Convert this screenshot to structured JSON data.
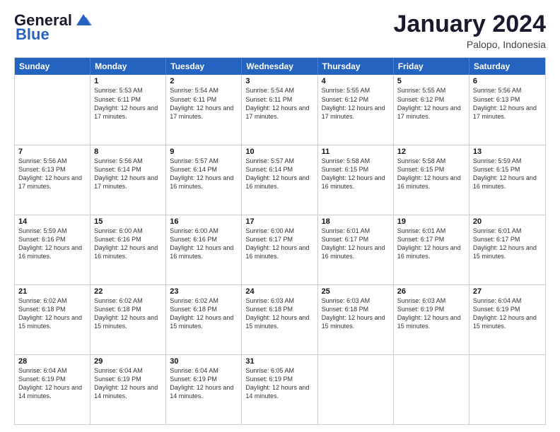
{
  "header": {
    "logo_line1": "General",
    "logo_line2": "Blue",
    "month_year": "January 2024",
    "location": "Palopo, Indonesia"
  },
  "days_of_week": [
    "Sunday",
    "Monday",
    "Tuesday",
    "Wednesday",
    "Thursday",
    "Friday",
    "Saturday"
  ],
  "weeks": [
    [
      {
        "day": "",
        "sunrise": "",
        "sunset": "",
        "daylight": ""
      },
      {
        "day": "1",
        "sunrise": "Sunrise: 5:53 AM",
        "sunset": "Sunset: 6:11 PM",
        "daylight": "Daylight: 12 hours and 17 minutes."
      },
      {
        "day": "2",
        "sunrise": "Sunrise: 5:54 AM",
        "sunset": "Sunset: 6:11 PM",
        "daylight": "Daylight: 12 hours and 17 minutes."
      },
      {
        "day": "3",
        "sunrise": "Sunrise: 5:54 AM",
        "sunset": "Sunset: 6:11 PM",
        "daylight": "Daylight: 12 hours and 17 minutes."
      },
      {
        "day": "4",
        "sunrise": "Sunrise: 5:55 AM",
        "sunset": "Sunset: 6:12 PM",
        "daylight": "Daylight: 12 hours and 17 minutes."
      },
      {
        "day": "5",
        "sunrise": "Sunrise: 5:55 AM",
        "sunset": "Sunset: 6:12 PM",
        "daylight": "Daylight: 12 hours and 17 minutes."
      },
      {
        "day": "6",
        "sunrise": "Sunrise: 5:56 AM",
        "sunset": "Sunset: 6:13 PM",
        "daylight": "Daylight: 12 hours and 17 minutes."
      }
    ],
    [
      {
        "day": "7",
        "sunrise": "Sunrise: 5:56 AM",
        "sunset": "Sunset: 6:13 PM",
        "daylight": "Daylight: 12 hours and 17 minutes."
      },
      {
        "day": "8",
        "sunrise": "Sunrise: 5:56 AM",
        "sunset": "Sunset: 6:14 PM",
        "daylight": "Daylight: 12 hours and 17 minutes."
      },
      {
        "day": "9",
        "sunrise": "Sunrise: 5:57 AM",
        "sunset": "Sunset: 6:14 PM",
        "daylight": "Daylight: 12 hours and 16 minutes."
      },
      {
        "day": "10",
        "sunrise": "Sunrise: 5:57 AM",
        "sunset": "Sunset: 6:14 PM",
        "daylight": "Daylight: 12 hours and 16 minutes."
      },
      {
        "day": "11",
        "sunrise": "Sunrise: 5:58 AM",
        "sunset": "Sunset: 6:15 PM",
        "daylight": "Daylight: 12 hours and 16 minutes."
      },
      {
        "day": "12",
        "sunrise": "Sunrise: 5:58 AM",
        "sunset": "Sunset: 6:15 PM",
        "daylight": "Daylight: 12 hours and 16 minutes."
      },
      {
        "day": "13",
        "sunrise": "Sunrise: 5:59 AM",
        "sunset": "Sunset: 6:15 PM",
        "daylight": "Daylight: 12 hours and 16 minutes."
      }
    ],
    [
      {
        "day": "14",
        "sunrise": "Sunrise: 5:59 AM",
        "sunset": "Sunset: 6:16 PM",
        "daylight": "Daylight: 12 hours and 16 minutes."
      },
      {
        "day": "15",
        "sunrise": "Sunrise: 6:00 AM",
        "sunset": "Sunset: 6:16 PM",
        "daylight": "Daylight: 12 hours and 16 minutes."
      },
      {
        "day": "16",
        "sunrise": "Sunrise: 6:00 AM",
        "sunset": "Sunset: 6:16 PM",
        "daylight": "Daylight: 12 hours and 16 minutes."
      },
      {
        "day": "17",
        "sunrise": "Sunrise: 6:00 AM",
        "sunset": "Sunset: 6:17 PM",
        "daylight": "Daylight: 12 hours and 16 minutes."
      },
      {
        "day": "18",
        "sunrise": "Sunrise: 6:01 AM",
        "sunset": "Sunset: 6:17 PM",
        "daylight": "Daylight: 12 hours and 16 minutes."
      },
      {
        "day": "19",
        "sunrise": "Sunrise: 6:01 AM",
        "sunset": "Sunset: 6:17 PM",
        "daylight": "Daylight: 12 hours and 16 minutes."
      },
      {
        "day": "20",
        "sunrise": "Sunrise: 6:01 AM",
        "sunset": "Sunset: 6:17 PM",
        "daylight": "Daylight: 12 hours and 15 minutes."
      }
    ],
    [
      {
        "day": "21",
        "sunrise": "Sunrise: 6:02 AM",
        "sunset": "Sunset: 6:18 PM",
        "daylight": "Daylight: 12 hours and 15 minutes."
      },
      {
        "day": "22",
        "sunrise": "Sunrise: 6:02 AM",
        "sunset": "Sunset: 6:18 PM",
        "daylight": "Daylight: 12 hours and 15 minutes."
      },
      {
        "day": "23",
        "sunrise": "Sunrise: 6:02 AM",
        "sunset": "Sunset: 6:18 PM",
        "daylight": "Daylight: 12 hours and 15 minutes."
      },
      {
        "day": "24",
        "sunrise": "Sunrise: 6:03 AM",
        "sunset": "Sunset: 6:18 PM",
        "daylight": "Daylight: 12 hours and 15 minutes."
      },
      {
        "day": "25",
        "sunrise": "Sunrise: 6:03 AM",
        "sunset": "Sunset: 6:18 PM",
        "daylight": "Daylight: 12 hours and 15 minutes."
      },
      {
        "day": "26",
        "sunrise": "Sunrise: 6:03 AM",
        "sunset": "Sunset: 6:19 PM",
        "daylight": "Daylight: 12 hours and 15 minutes."
      },
      {
        "day": "27",
        "sunrise": "Sunrise: 6:04 AM",
        "sunset": "Sunset: 6:19 PM",
        "daylight": "Daylight: 12 hours and 15 minutes."
      }
    ],
    [
      {
        "day": "28",
        "sunrise": "Sunrise: 6:04 AM",
        "sunset": "Sunset: 6:19 PM",
        "daylight": "Daylight: 12 hours and 14 minutes."
      },
      {
        "day": "29",
        "sunrise": "Sunrise: 6:04 AM",
        "sunset": "Sunset: 6:19 PM",
        "daylight": "Daylight: 12 hours and 14 minutes."
      },
      {
        "day": "30",
        "sunrise": "Sunrise: 6:04 AM",
        "sunset": "Sunset: 6:19 PM",
        "daylight": "Daylight: 12 hours and 14 minutes."
      },
      {
        "day": "31",
        "sunrise": "Sunrise: 6:05 AM",
        "sunset": "Sunset: 6:19 PM",
        "daylight": "Daylight: 12 hours and 14 minutes."
      },
      {
        "day": "",
        "sunrise": "",
        "sunset": "",
        "daylight": ""
      },
      {
        "day": "",
        "sunrise": "",
        "sunset": "",
        "daylight": ""
      },
      {
        "day": "",
        "sunrise": "",
        "sunset": "",
        "daylight": ""
      }
    ]
  ]
}
